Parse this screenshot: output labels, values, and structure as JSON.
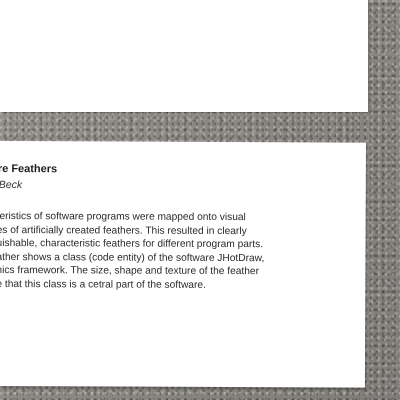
{
  "label": {
    "title": "re Feathers",
    "author": "Beck",
    "body_lines": [
      "teristics of software programs were mapped onto visual",
      "es of artificially created feathers. This resulted in clearly",
      "uishable, characteristic feathers for different program parts.",
      "ather shows a class (code entity) of the software JHotDraw,",
      "hics framework. The size, shape and texture of the feather",
      "e that this class is a cetral part of the software."
    ]
  }
}
